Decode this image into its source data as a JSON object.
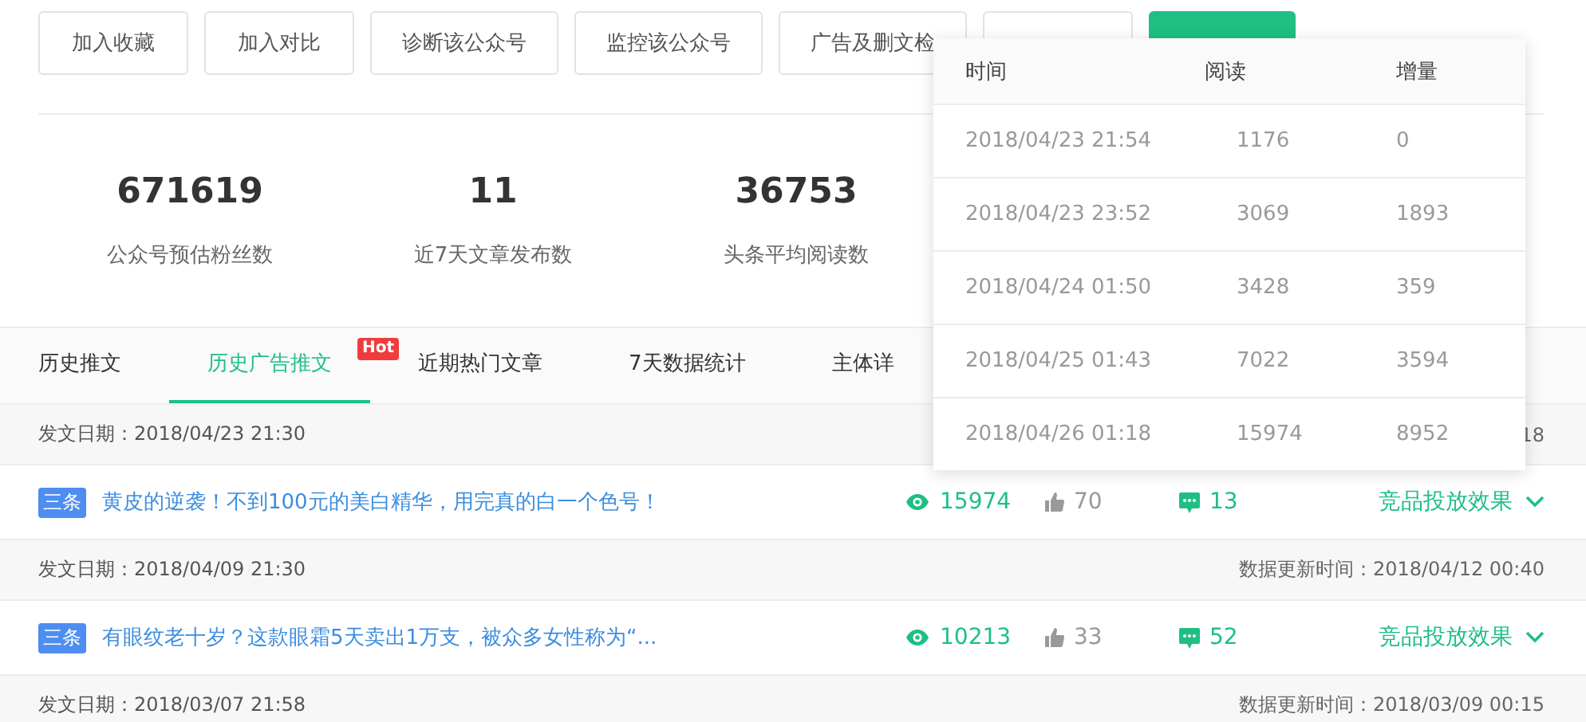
{
  "actions": [
    {
      "label": "加入收藏",
      "kind": "plain"
    },
    {
      "label": "加入对比",
      "kind": "plain"
    },
    {
      "label": "诊断该公众号",
      "kind": "plain"
    },
    {
      "label": "监控该公众号",
      "kind": "plain"
    },
    {
      "label": "广告及删文检",
      "kind": "plain"
    },
    {
      "kind": "plain"
    },
    {
      "kind": "primary"
    }
  ],
  "stats": [
    {
      "value": "671619",
      "label": "公众号预估粉丝数"
    },
    {
      "value": "11",
      "label": "近7天文章发布数"
    },
    {
      "value": "36753",
      "label": "头条平均阅读数"
    }
  ],
  "tabs": [
    {
      "label": "历史推文",
      "selected": false
    },
    {
      "label": "历史广告推文",
      "selected": true,
      "badge": "Hot"
    },
    {
      "label": "近期热门文章",
      "selected": false
    },
    {
      "label": "7天数据统计",
      "selected": false
    },
    {
      "label": "主体详",
      "selected": false
    }
  ],
  "posts": [
    {
      "date": "发文日期：2018/04/23 21:30",
      "updated": "18",
      "tag": "三条",
      "title": "黄皮的逆袭！不到100元的美白精华，用完真的白一个色号！",
      "reads": "15974",
      "likes": "70",
      "comments": "13",
      "action": "竞品投放效果"
    },
    {
      "date": "发文日期：2018/04/09 21:30",
      "updated": "数据更新时间：2018/04/12 00:40",
      "tag": "三条",
      "title": "有眼纹老十岁？这款眼霜5天卖出1万支，被众多女性称为“...",
      "reads": "10213",
      "likes": "33",
      "comments": "52",
      "action": "竞品投放效果"
    },
    {
      "date": "发文日期：2018/03/07 21:58",
      "updated": "数据更新时间：2018/03/09 00:15"
    }
  ],
  "popup": {
    "columns": [
      "时间",
      "阅读",
      "增量"
    ],
    "rows": [
      [
        "2018/04/23 21:54",
        "1176",
        "0"
      ],
      [
        "2018/04/23 23:52",
        "3069",
        "1893"
      ],
      [
        "2018/04/24 01:50",
        "3428",
        "359"
      ],
      [
        "2018/04/25 01:43",
        "7022",
        "3594"
      ],
      [
        "2018/04/26 01:18",
        "15974",
        "8952"
      ]
    ]
  }
}
